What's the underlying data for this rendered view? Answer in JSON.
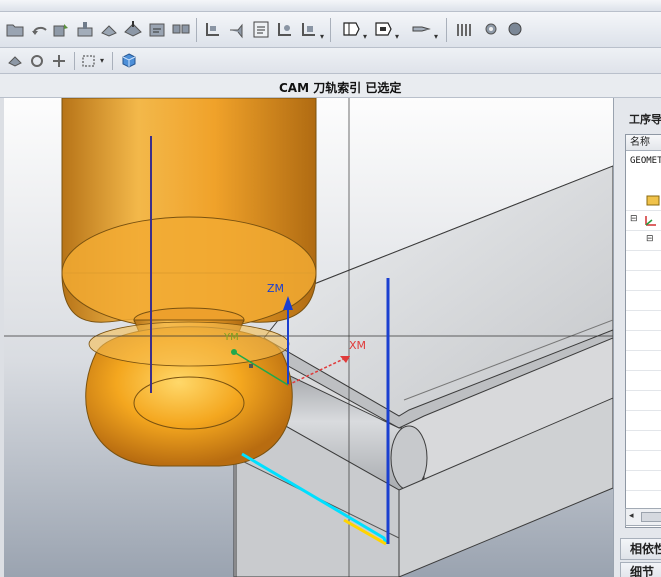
{
  "toolbar": {
    "icons": [
      "open-folder-icon",
      "undo-icon",
      "redo-icon",
      "create-operation-icon",
      "tool-icon",
      "geometry-icon",
      "method-icon",
      "program-icon",
      "generate-toolpath-icon",
      "verify-icon",
      "postprocess-icon",
      "list-icon",
      "display-icon",
      "edit-icon",
      "shop-doc-icon",
      "cut-icon",
      "copy-icon",
      "paste-icon"
    ],
    "small_icons": [
      "view-shade-icon",
      "rotate-icon",
      "pan-icon",
      "select-box-icon",
      "solid-cube-icon"
    ]
  },
  "status": {
    "text": "CAM 刀轨索引 已选定"
  },
  "viewport": {
    "axes": {
      "zm": "ZM",
      "xm": "XM",
      "ym": "YM"
    },
    "colors": {
      "tool": "#f0a320",
      "tool_edge": "#7a5210",
      "stock": "#c8c9cb",
      "background_top": "#fbfbfb",
      "background_bottom": "#9aa3b0",
      "zm_axis": "#1a3fd0",
      "xm_axis": "#e03a3a",
      "ym_axis": "#1fa84c",
      "toolpath_cyan": "#00e0ff",
      "toolpath_yellow": "#ffd400",
      "tool_axis": "#3c2f8a"
    }
  },
  "navigator": {
    "title": "工序导航器",
    "column_name": "名称",
    "geometry_row": "GEOMETRY",
    "dependencies": "相依性",
    "details": "细节"
  }
}
